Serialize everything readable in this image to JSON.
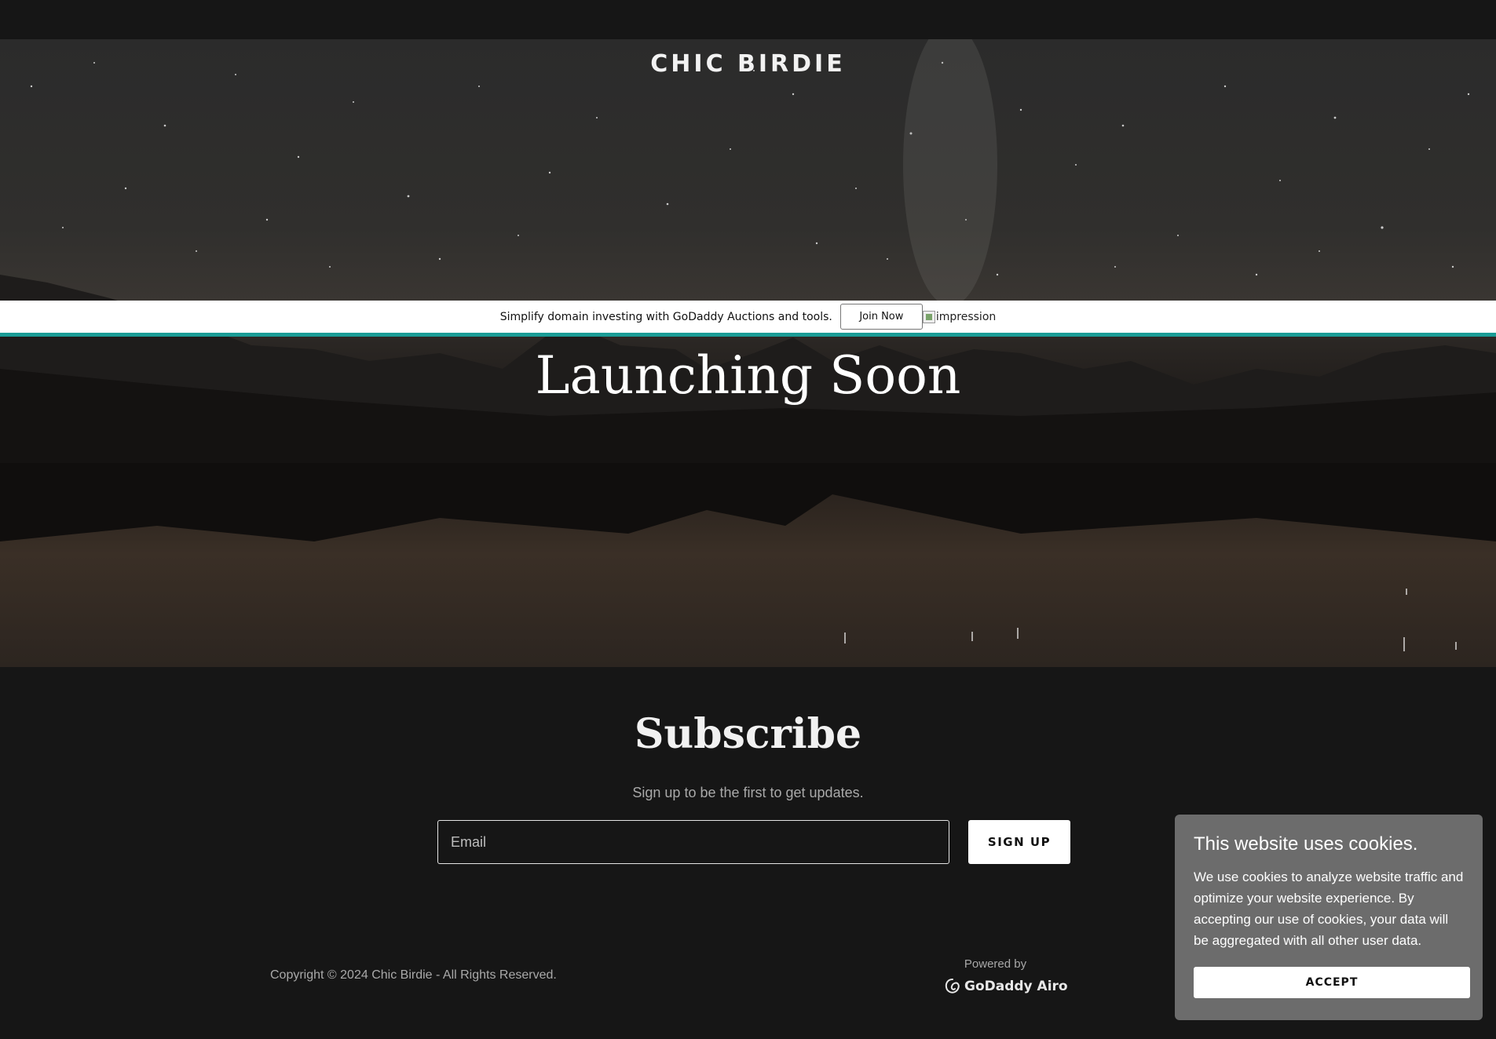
{
  "site": {
    "brand": "CHIC BIRDIE"
  },
  "banner": {
    "text": "Simplify domain investing with GoDaddy Auctions and tools.",
    "button_label": "Join Now",
    "image_alt": "impression"
  },
  "hero": {
    "headline": "Launching Soon"
  },
  "subscribe": {
    "title": "Subscribe",
    "subtitle": "Sign up to be the first to get updates.",
    "email_placeholder": "Email",
    "button_label": "SIGN UP"
  },
  "footer": {
    "copyright": "Copyright © 2024 Chic Birdie - All Rights Reserved.",
    "powered_by": "Powered by",
    "logo_text": "GoDaddy Airo"
  },
  "cookie": {
    "title": "This website uses cookies.",
    "body": "We use cookies to analyze website traffic and optimize your website experience. By accepting our use of cookies, your data will be aggregated with all other user data.",
    "accept_label": "ACCEPT"
  },
  "colors": {
    "banner_accent": "#1a9c96",
    "page_bg": "#161616",
    "cookie_bg": "#6c6c6c"
  }
}
